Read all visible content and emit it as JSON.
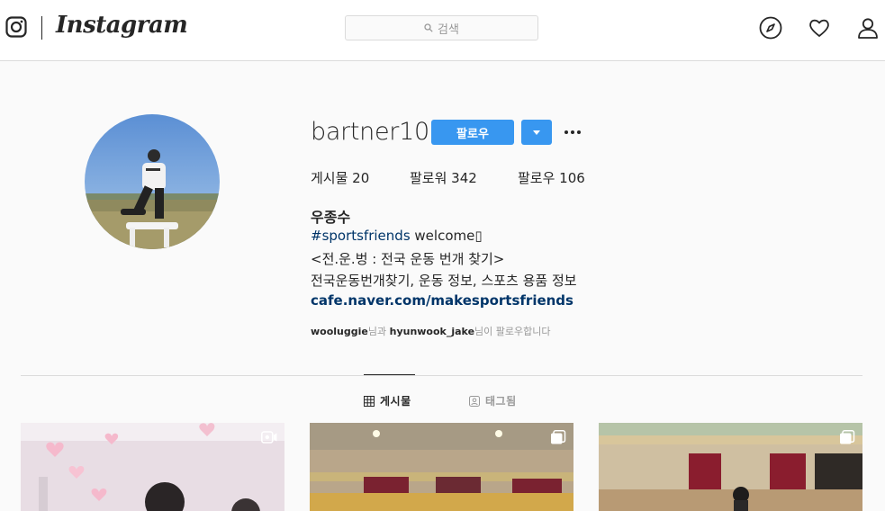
{
  "brand": {
    "wordmark": "Instagram"
  },
  "search": {
    "placeholder": "검색"
  },
  "nav_icons": [
    "explore-compass-icon",
    "activity-heart-icon",
    "profile-person-icon"
  ],
  "profile": {
    "username": "bartner10",
    "follow_label": "팔로우",
    "stats": {
      "posts": "게시물 20",
      "followers": "팔로워 342",
      "following": "팔로우 106"
    },
    "full_name": "우종수",
    "bio_hashtag": "#sportsfriends",
    "bio_line1_rest": " welcome▯",
    "bio_line2": "<전.운.벙 : 전국 운동 번개 찾기>",
    "bio_line3": "전국운동번개찾기, 운동 정보, 스포츠 용품 정보",
    "website": "cafe.naver.com/makesportsfriends",
    "followed_by": {
      "user1": "wooluggie",
      "conj": "님과 ",
      "user2": "hyunwook_jake",
      "suffix": "님이 팔로우합니다"
    }
  },
  "tabs": [
    {
      "label": "게시물",
      "icon": "grid-icon",
      "active": true
    },
    {
      "label": "태그됨",
      "icon": "tagged-person-icon",
      "active": false
    }
  ],
  "posts": [
    {
      "type": "video",
      "badge": "video-icon"
    },
    {
      "type": "carousel",
      "badge": "carousel-icon"
    },
    {
      "type": "carousel",
      "badge": "carousel-icon"
    }
  ],
  "colors": {
    "accent": "#3897f0",
    "link": "#003569",
    "muted": "#999999",
    "text": "#262626",
    "border": "#dbdbdb"
  }
}
